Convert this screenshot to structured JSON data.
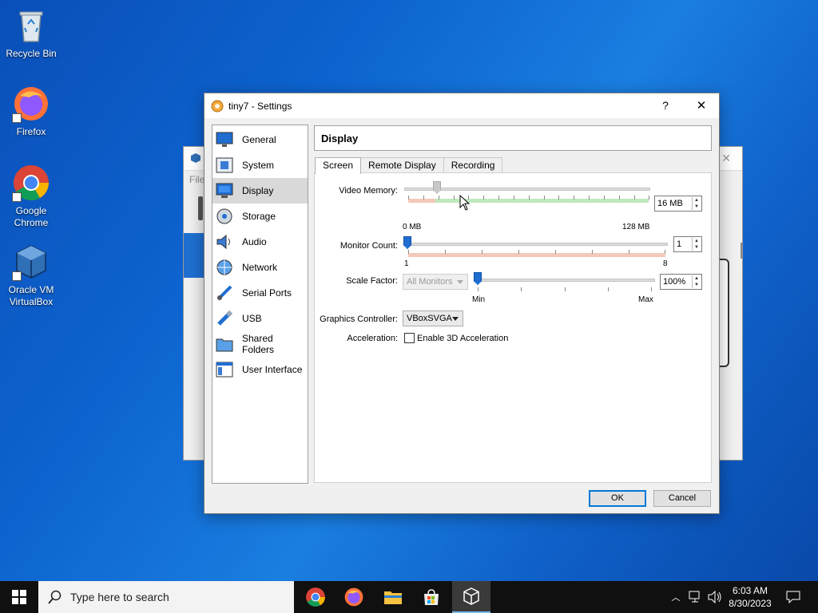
{
  "desktop": {
    "icons": [
      {
        "label": "Recycle Bin"
      },
      {
        "label": "Firefox"
      },
      {
        "label": "Google Chrome"
      },
      {
        "label": "Oracle VM VirtualBox"
      }
    ],
    "background_window": {
      "menu_fragment": "File"
    }
  },
  "dialog": {
    "title": "tiny7 - Settings",
    "help_label": "?",
    "close_label": "✕",
    "sidebar": [
      {
        "label": "General",
        "icon": "monitor-icon",
        "active": false
      },
      {
        "label": "System",
        "icon": "chip-icon",
        "active": false
      },
      {
        "label": "Display",
        "icon": "display-icon",
        "active": true
      },
      {
        "label": "Storage",
        "icon": "disk-icon",
        "active": false
      },
      {
        "label": "Audio",
        "icon": "speaker-icon",
        "active": false
      },
      {
        "label": "Network",
        "icon": "network-icon",
        "active": false
      },
      {
        "label": "Serial Ports",
        "icon": "serial-port-icon",
        "active": false
      },
      {
        "label": "USB",
        "icon": "usb-icon",
        "active": false
      },
      {
        "label": "Shared Folders",
        "icon": "folder-icon",
        "active": false
      },
      {
        "label": "User Interface",
        "icon": "window-icon",
        "active": false
      }
    ],
    "page_title": "Display",
    "tabs": [
      {
        "label": "Screen",
        "active": true
      },
      {
        "label": "Remote Display",
        "active": false
      },
      {
        "label": "Recording",
        "active": false
      }
    ],
    "screen": {
      "video_memory": {
        "label": "Video Memory:",
        "value": "16 MB",
        "min_label": "0 MB",
        "max_label": "128 MB",
        "value_mb": 16,
        "max_mb": 128
      },
      "monitor_count": {
        "label": "Monitor Count:",
        "value": "1",
        "min_label": "1",
        "max_label": "8"
      },
      "scale_factor": {
        "label": "Scale Factor:",
        "monitors_combo": "All Monitors",
        "value": "100%",
        "min_label": "Min",
        "max_label": "Max"
      },
      "graphics_controller": {
        "label": "Graphics Controller:",
        "value": "VBoxSVGA"
      },
      "acceleration": {
        "label": "Acceleration:",
        "checkbox_label": "Enable 3D Acceleration",
        "checked": false
      }
    },
    "buttons": {
      "ok": "OK",
      "cancel": "Cancel"
    }
  },
  "taskbar": {
    "search_placeholder": "Type here to search",
    "apps": [
      {
        "name": "chrome-icon"
      },
      {
        "name": "firefox-icon"
      },
      {
        "name": "file-explorer-icon"
      },
      {
        "name": "store-icon"
      },
      {
        "name": "virtualbox-icon"
      }
    ],
    "time": "6:03 AM",
    "date": "8/30/2023"
  }
}
